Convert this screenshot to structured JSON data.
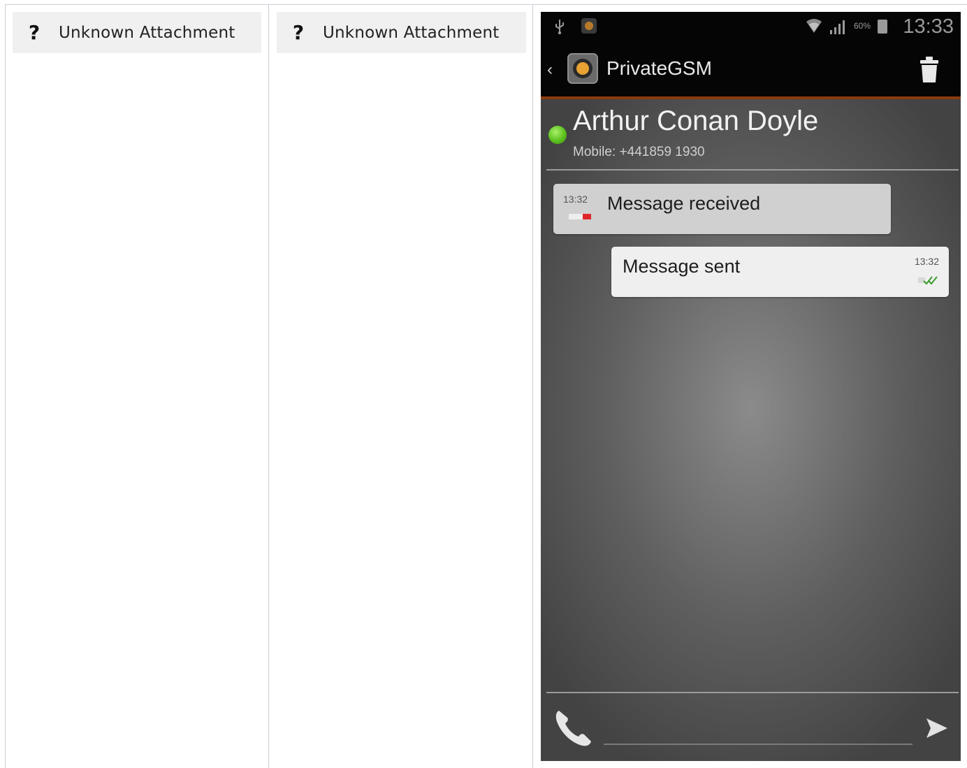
{
  "attachments": [
    {
      "icon": "?",
      "label": "Unknown Attachment"
    },
    {
      "icon": "?",
      "label": "Unknown Attachment"
    }
  ],
  "phone": {
    "status_bar": {
      "battery_percent": "60%",
      "time": "13:33",
      "icons": [
        "usb-icon",
        "app-notification-icon",
        "wifi-icon",
        "signal-icon",
        "battery-icon"
      ]
    },
    "action_bar": {
      "back_glyph": "‹",
      "app_name": "PrivateGSM",
      "logo": "privategsm-logo",
      "delete_icon": "trash-icon",
      "accent_color": "#8a3a0e"
    },
    "contact": {
      "name": "Arthur Conan Doyle",
      "number": "Mobile: +441859 1930",
      "status": "online",
      "status_color": "#5cc11e"
    },
    "messages": [
      {
        "direction": "received",
        "time": "13:32",
        "text": "Message received"
      },
      {
        "direction": "sent",
        "time": "13:32",
        "text": "Message sent"
      }
    ],
    "composer": {
      "call_icon": "phone-icon",
      "send_icon": "send-icon"
    }
  }
}
